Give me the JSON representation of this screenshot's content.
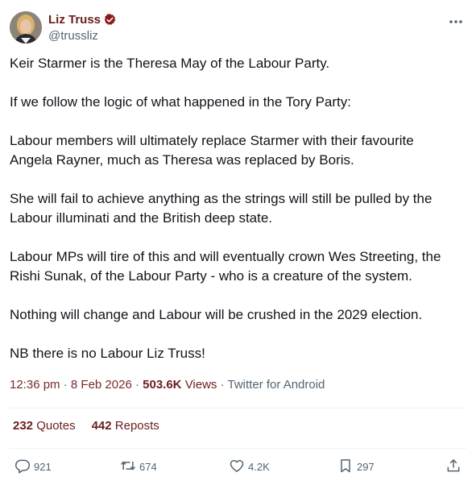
{
  "author": {
    "display_name": "Liz Truss",
    "handle": "@trussliz"
  },
  "tweet": {
    "paragraphs": [
      "Keir Starmer is the Theresa May of the Labour Party.",
      "If we follow the logic of what happened in the Tory Party:",
      "Labour members will ultimately replace Starmer with their favourite\nAngela Rayner, much as Theresa was replaced by Boris.",
      "She will fail to achieve anything as the strings will still be pulled by the\nLabour illuminati and the British deep state.",
      "Labour MPs will tire of this and will eventually crown Wes Streeting, the\nRishi Sunak, of the Labour Party - who is a creature of the system.",
      "Nothing will change and Labour will be crushed in the 2029 election.",
      "NB there is no Labour Liz Truss!"
    ]
  },
  "meta": {
    "time": "12:36 pm",
    "date": "8 Feb 2026",
    "views_count": "503.6K",
    "views_label": "Views",
    "client": "Twitter for Android",
    "separator": "·"
  },
  "stats": {
    "quotes_count": "232",
    "quotes_label": "Quotes",
    "reposts_count": "442",
    "reposts_label": "Reposts"
  },
  "actions": {
    "replies": "921",
    "reposts": "674",
    "likes": "4.2K",
    "bookmarks": "297"
  },
  "colors": {
    "accent": "#6b1d1d",
    "secondary_text": "#536471",
    "divider": "#eff3f4"
  }
}
